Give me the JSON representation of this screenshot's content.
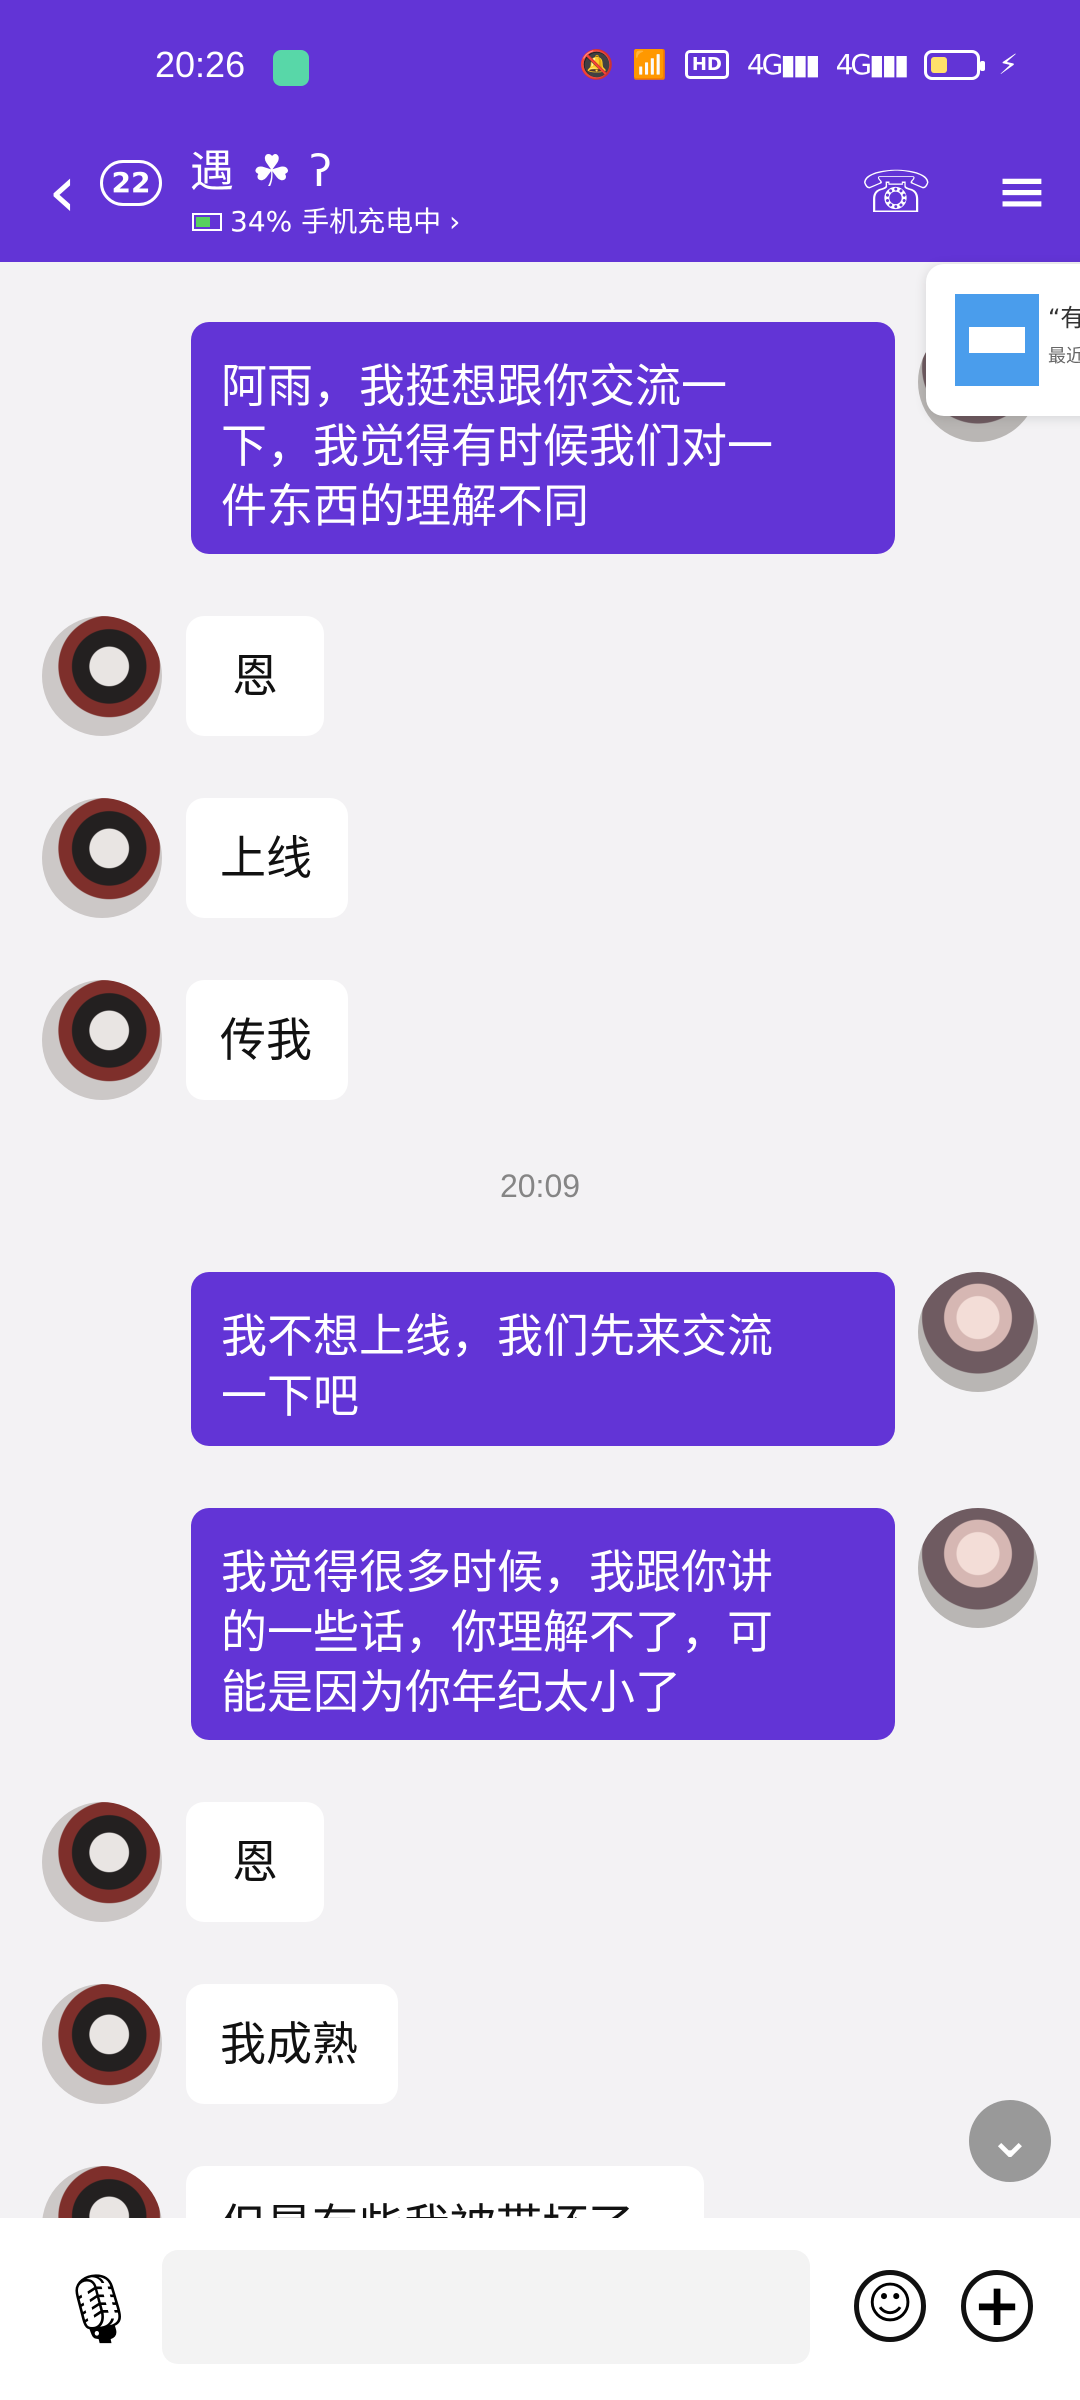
{
  "status_bar": {
    "time": "20:26",
    "hd_label": "HD",
    "network_4g_1": "4G",
    "network_4g_2": "4G"
  },
  "nav": {
    "unread_count": "22",
    "contact_name": "遇",
    "status_text": "34% 手机充电中"
  },
  "messages": [
    {
      "side": "out",
      "text": "阿雨，我挺想跟你交流一\n下，我觉得有时候我们对一\n件东西的理解不同"
    },
    {
      "side": "in",
      "text": "恩"
    },
    {
      "side": "in",
      "text": "上线"
    },
    {
      "side": "in",
      "text": "传我"
    },
    {
      "side": "out",
      "text": "我不想上线，我们先来交流\n一下吧"
    },
    {
      "side": "out",
      "text": "我觉得很多时候，我跟你讲\n的一些话，你理解不了，可\n能是因为你年纪太小了"
    },
    {
      "side": "in",
      "text": "恩"
    },
    {
      "side": "in",
      "text": "我成熟"
    },
    {
      "side": "in",
      "text": "但是有些我被带坏了"
    }
  ],
  "timestamp_sep": "20:09",
  "side_card": {
    "title": "“有",
    "text": "最近"
  },
  "icons": {
    "back": "chevron-left-icon",
    "phone": "phone-icon",
    "menu": "menu-icon",
    "voice": "microphone-icon",
    "emoji": "smile-icon",
    "add": "plus-icon",
    "scroll": "chevron-down-icon"
  },
  "colors": {
    "accent": "#6234d6",
    "chat_bg": "#f3f2f4",
    "incoming_bubble": "#ffffff"
  }
}
